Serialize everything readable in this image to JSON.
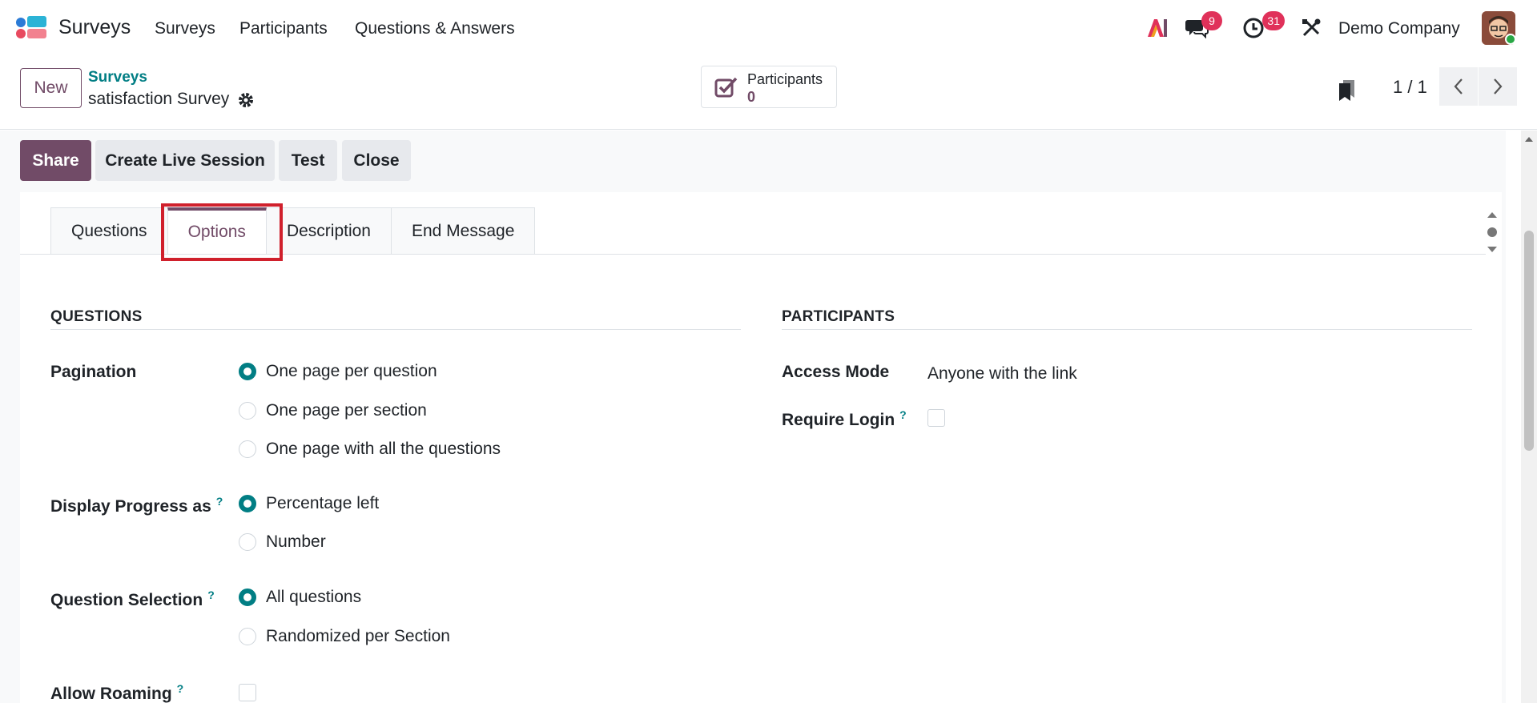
{
  "navbar": {
    "app_name": "Surveys",
    "menu": [
      "Surveys",
      "Participants",
      "Questions & Answers"
    ],
    "messages_count": "9",
    "activities_count": "31",
    "company": "Demo Company",
    "accent": "#714b67",
    "badge_color": "#e0315a"
  },
  "control": {
    "new_label": "New",
    "breadcrumb_parent": "Surveys",
    "breadcrumb_current": "satisfaction Survey",
    "stat_label": "Participants",
    "stat_value": "0",
    "pager": "1 / 1"
  },
  "actions": {
    "share": "Share",
    "create_live_session": "Create Live Session",
    "test": "Test",
    "close": "Close"
  },
  "tabs": {
    "questions": "Questions",
    "options": "Options",
    "description": "Description",
    "end_message": "End Message"
  },
  "questions_section": {
    "title": "QUESTIONS",
    "pagination": {
      "label": "Pagination",
      "options": [
        "One page per question",
        "One page per section",
        "One page with all the questions"
      ],
      "selected": 0
    },
    "progress": {
      "label": "Display Progress as",
      "options": [
        "Percentage left",
        "Number"
      ],
      "selected": 0
    },
    "selection": {
      "label": "Question Selection",
      "options": [
        "All questions",
        "Randomized per Section"
      ],
      "selected": 0
    },
    "roaming": {
      "label": "Allow Roaming"
    }
  },
  "participants_section": {
    "title": "PARTICIPANTS",
    "access_mode_label": "Access Mode",
    "access_mode_value": "Anyone with the link",
    "require_login_label": "Require Login"
  },
  "help_mark": "?"
}
